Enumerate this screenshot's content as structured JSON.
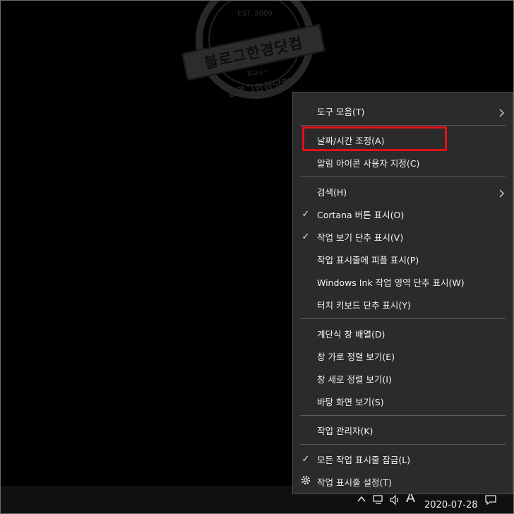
{
  "watermark": {
    "est": "EST. 2009",
    "banner": "블로그한경닷컴",
    "small": "알고니™",
    "bottom": "블로그한경닷컴"
  },
  "menu": {
    "toolbars": "도구 모음(T)",
    "adjust_datetime": "날짜/시간 조정(A)",
    "customize_notification_icons": "알림 아이콘 사용자 지정(C)",
    "search": "검색(H)",
    "show_cortana": "Cortana 버튼 표시(O)",
    "show_task_view": "작업 보기 단추 표시(V)",
    "show_people": "작업 표시줄에 피플 표시(P)",
    "show_ink": "Windows Ink 작업 영역 단추 표시(W)",
    "show_touch_keyboard": "터치 키보드 단추 표시(Y)",
    "cascade": "계단식 창 배열(D)",
    "stacked": "창 가로 정렬 보기(E)",
    "side_by_side": "창 세로 정렬 보기(I)",
    "show_desktop": "바탕 화면 보기(S)",
    "task_manager": "작업 관리자(K)",
    "lock_taskbars": "모든 작업 표시줄 잠금(L)",
    "taskbar_settings": "작업 표시줄 설정(T)",
    "check_mark": "✓"
  },
  "taskbar": {
    "ime_indicator": "A",
    "date": "2020-07-28"
  },
  "colors": {
    "menu_bg": "#2b2b2b",
    "highlight": "#e0101a"
  }
}
